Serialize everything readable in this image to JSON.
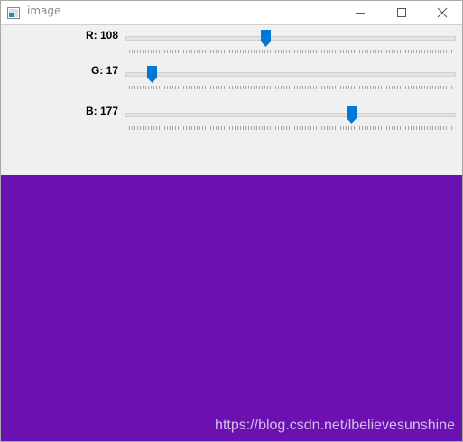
{
  "window": {
    "title": "image"
  },
  "trackbars": [
    {
      "name": "R",
      "label": "R: 108",
      "value": 108,
      "max": 255
    },
    {
      "name": "G",
      "label": "G: 17",
      "value": 17,
      "max": 255
    },
    {
      "name": "B",
      "label": "B: 177",
      "value": 177,
      "max": 255
    }
  ],
  "canvas": {
    "color": "#6c11b1"
  },
  "watermark": "https://blog.csdn.net/lbelievesunshine",
  "colors": {
    "accent": "#0078d7",
    "panel_bg": "#f0f0f0"
  },
  "icons": {
    "app": "image-window-icon",
    "minimize": "minimize-icon",
    "maximize": "maximize-icon",
    "close": "close-icon"
  }
}
